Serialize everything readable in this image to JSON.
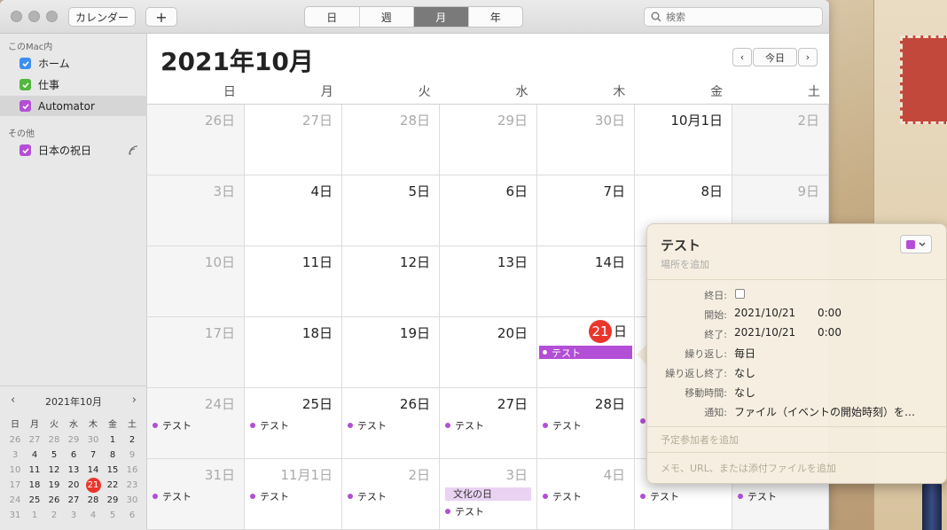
{
  "toolbar": {
    "calendars_button": "カレンダー",
    "add_button": "+",
    "views": [
      {
        "label": "日",
        "active": false
      },
      {
        "label": "週",
        "active": false
      },
      {
        "label": "月",
        "active": true
      },
      {
        "label": "年",
        "active": false
      }
    ],
    "search_placeholder": "検索"
  },
  "sidebar": {
    "section_mac": "このMac内",
    "section_other": "その他",
    "calendars": [
      {
        "label": "ホーム",
        "color": "#3d8ef2"
      },
      {
        "label": "仕事",
        "color": "#52b73d"
      },
      {
        "label": "Automator",
        "color": "#b34ed6",
        "selected": true
      }
    ],
    "other_calendars": [
      {
        "label": "日本の祝日",
        "color": "#b34ed6"
      }
    ]
  },
  "mini_calendar": {
    "title": "2021年10月",
    "weekdays": [
      "日",
      "月",
      "火",
      "水",
      "木",
      "金",
      "土"
    ],
    "weeks": [
      [
        [
          "26",
          "dim"
        ],
        [
          "27",
          "dim"
        ],
        [
          "28",
          "dim"
        ],
        [
          "29",
          "dim"
        ],
        [
          "30",
          "dim"
        ],
        [
          "1",
          ""
        ],
        [
          "2",
          ""
        ]
      ],
      [
        [
          "3",
          "dim"
        ],
        [
          "4",
          ""
        ],
        [
          "5",
          ""
        ],
        [
          "6",
          ""
        ],
        [
          "7",
          ""
        ],
        [
          "8",
          ""
        ],
        [
          "9",
          "dim"
        ]
      ],
      [
        [
          "10",
          "dim"
        ],
        [
          "11",
          ""
        ],
        [
          "12",
          ""
        ],
        [
          "13",
          ""
        ],
        [
          "14",
          ""
        ],
        [
          "15",
          ""
        ],
        [
          "16",
          "dim"
        ]
      ],
      [
        [
          "17",
          "dim"
        ],
        [
          "18",
          ""
        ],
        [
          "19",
          ""
        ],
        [
          "20",
          ""
        ],
        [
          "21",
          "today"
        ],
        [
          "22",
          ""
        ],
        [
          "23",
          "dim"
        ]
      ],
      [
        [
          "24",
          "dim"
        ],
        [
          "25",
          ""
        ],
        [
          "26",
          ""
        ],
        [
          "27",
          ""
        ],
        [
          "28",
          ""
        ],
        [
          "29",
          ""
        ],
        [
          "30",
          "dim"
        ]
      ],
      [
        [
          "31",
          "dim"
        ],
        [
          "1",
          "dim"
        ],
        [
          "2",
          "dim"
        ],
        [
          "3",
          "dim"
        ],
        [
          "4",
          "dim"
        ],
        [
          "5",
          "dim"
        ],
        [
          "6",
          "dim"
        ]
      ]
    ]
  },
  "main": {
    "month_title": "2021年10月",
    "today_button": "今日",
    "weekday_headers": [
      "日",
      "月",
      "火",
      "水",
      "木",
      "金",
      "土"
    ],
    "weeks": [
      [
        {
          "d": "26日",
          "dim": true
        },
        {
          "d": "27日",
          "dim": true
        },
        {
          "d": "28日",
          "dim": true
        },
        {
          "d": "29日",
          "dim": true
        },
        {
          "d": "30日",
          "dim": true
        },
        {
          "d": "10月1日"
        },
        {
          "d": "2日",
          "dim": true
        }
      ],
      [
        {
          "d": "3日",
          "dim": true
        },
        {
          "d": "4日"
        },
        {
          "d": "5日"
        },
        {
          "d": "6日"
        },
        {
          "d": "7日"
        },
        {
          "d": "8日"
        },
        {
          "d": "9日",
          "dim": true
        }
      ],
      [
        {
          "d": "10日",
          "dim": true
        },
        {
          "d": "11日"
        },
        {
          "d": "12日"
        },
        {
          "d": "13日"
        },
        {
          "d": "14日"
        },
        {
          "d": ""
        },
        {
          "d": ""
        }
      ],
      [
        {
          "d": "17日",
          "dim": true
        },
        {
          "d": "18日"
        },
        {
          "d": "19日"
        },
        {
          "d": "20日"
        },
        {
          "d": "日",
          "today": "21",
          "bar": "テスト"
        },
        {
          "d": ""
        },
        {
          "d": ""
        }
      ],
      [
        {
          "d": "24日",
          "dim": true,
          "ev": [
            "テスト"
          ]
        },
        {
          "d": "25日",
          "ev": [
            "テスト"
          ]
        },
        {
          "d": "26日",
          "ev": [
            "テスト"
          ]
        },
        {
          "d": "27日",
          "ev": [
            "テスト"
          ]
        },
        {
          "d": "28日",
          "ev": [
            "テスト"
          ]
        },
        {
          "d": "",
          "ev": [
            ""
          ]
        },
        {
          "d": ""
        }
      ],
      [
        {
          "d": "31日",
          "dim": true,
          "ev": [
            "テスト"
          ]
        },
        {
          "d": "11月1日",
          "dim": true,
          "ev": [
            "テスト"
          ]
        },
        {
          "d": "2日",
          "dim": true,
          "ev": [
            "テスト"
          ]
        },
        {
          "d": "3日",
          "dim": true,
          "holiday": "文化の日",
          "ev": [
            "テスト"
          ]
        },
        {
          "d": "4日",
          "dim": true,
          "ev": [
            "テスト"
          ]
        },
        {
          "d": "",
          "ev": [
            "テスト"
          ]
        },
        {
          "d": "",
          "ev": [
            "テスト"
          ]
        }
      ]
    ]
  },
  "popover": {
    "title": "テスト",
    "location_placeholder": "場所を追加",
    "color": "#b34ed6",
    "rows": [
      {
        "label": "終日:",
        "value": ""
      },
      {
        "label": "開始:",
        "value": "2021/10/21",
        "time": "0:00"
      },
      {
        "label": "終了:",
        "value": "2021/10/21",
        "time": "0:00"
      },
      {
        "label": "繰り返し:",
        "value": "毎日"
      },
      {
        "label": "繰り返し終了:",
        "value": "なし"
      },
      {
        "label": "移動時間:",
        "value": "なし"
      },
      {
        "label": "通知:",
        "value": "ファイル（イベントの開始時刻）を…"
      }
    ],
    "invitees_placeholder": "予定参加者を追加",
    "notes_placeholder": "メモ、URL、または添付ファイルを追加"
  }
}
